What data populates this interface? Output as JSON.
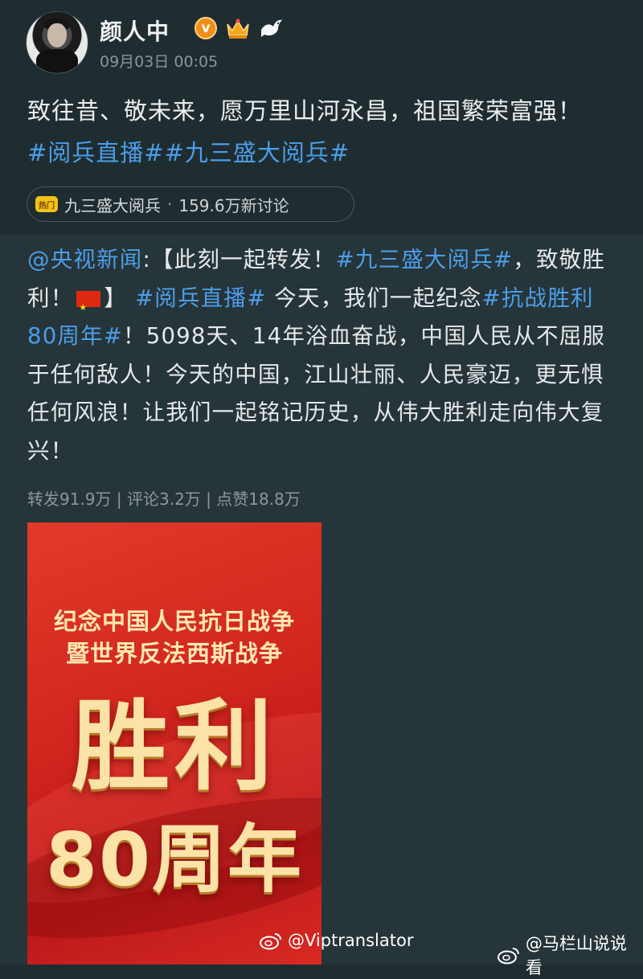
{
  "user": {
    "name": "颜人中",
    "timestamp": "09月03日 00:05",
    "verified_label": "v"
  },
  "post": {
    "text_plain": "致往昔、敬未来，愿万里山河永昌，祖国繁荣富强！",
    "hashtags": [
      "#阅兵直播#",
      "#九三盛大阅兵#"
    ]
  },
  "topic": {
    "icon_label": "热门",
    "label": "九三盛大阅兵",
    "separator": " · ",
    "discussion": "159.6万新讨论"
  },
  "retweet": {
    "mention": "@央视新闻",
    "colon": ":",
    "seg1": "【此刻一起转发！",
    "tag1": "#九三盛大阅兵#",
    "seg2": "，致敬胜利！",
    "seg3": "】",
    "tag2": "#阅兵直播#",
    "seg4": " 今天，我们一起纪念",
    "tag3": "#抗战胜利80周年#",
    "seg5": "！5098天、14年浴血奋战，中国人民从不屈服于任何敌人！今天的中国，江山壮丽、人民豪迈，更无惧任何风浪！让我们一起铭记历史，从伟大胜利走向伟大复兴！",
    "stats": "转发91.9万 | 评论3.2万 | 点赞18.8万"
  },
  "poster": {
    "line1": "纪念中国人民抗日战争",
    "line2": "暨世界反法西斯战争",
    "big1": "胜利",
    "big2": "80周年"
  },
  "watermarks": [
    "@Viptranslator",
    "@马栏山说说看"
  ],
  "colors": {
    "background": "#1f2d31",
    "retweet_background": "#263539",
    "hashtag": "#4c9de8",
    "poster_red": "#d0251d",
    "poster_gold": "#fbe2a6"
  }
}
